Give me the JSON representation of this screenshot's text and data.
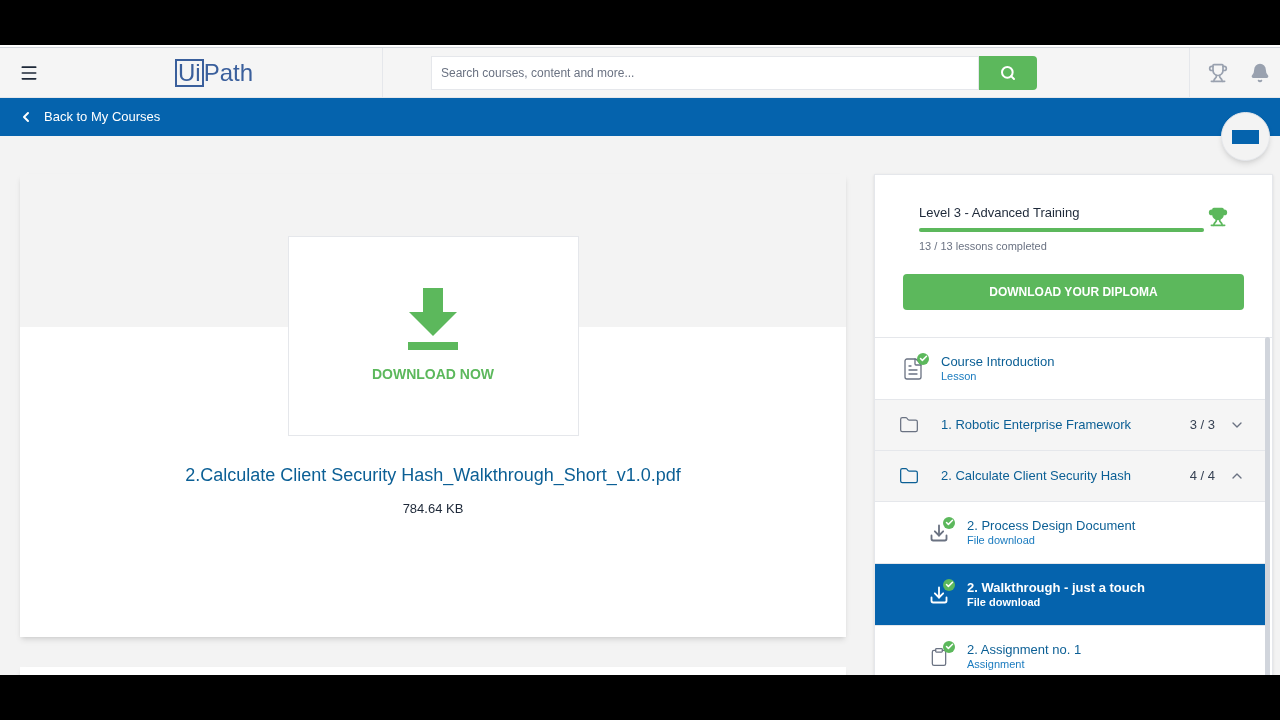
{
  "header": {
    "logo": {
      "boxed": "Ui",
      "rest": "Path"
    },
    "search": {
      "placeholder": "Search courses, content and more..."
    }
  },
  "back_link": {
    "label": "Back to My Courses"
  },
  "file": {
    "download_label": "DOWNLOAD NOW",
    "filename": "2.Calculate Client Security Hash_Walkthrough_Short_v1.0.pdf",
    "size": "784.64 KB"
  },
  "course": {
    "title": "Level 3 - Advanced Training",
    "level": 1.0,
    "progress_text": "13 / 13 lessons completed",
    "diploma_button": "DOWNLOAD YOUR DIPLOMA"
  },
  "lessons": [
    {
      "kind": "document",
      "title": "Course Introduction",
      "subtitle": "Lesson",
      "completed": true,
      "selected": false
    },
    {
      "kind": "section",
      "title": "1. Robotic Enterprise Framework",
      "count": "3 / 3",
      "expanded": false
    },
    {
      "kind": "section",
      "title": "2. Calculate Client Security Hash",
      "count": "4 / 4",
      "expanded": true,
      "children": [
        {
          "kind": "file_download",
          "title": "2. Process Design Document",
          "subtitle": "File download",
          "completed": true,
          "selected": false
        },
        {
          "kind": "file_download",
          "title": "2. Walkthrough - just a touch",
          "subtitle": "File download",
          "completed": true,
          "selected": true
        },
        {
          "kind": "assignment",
          "title": "2. Assignment no. 1",
          "subtitle": "Assignment",
          "completed": true,
          "selected": false
        }
      ]
    }
  ]
}
